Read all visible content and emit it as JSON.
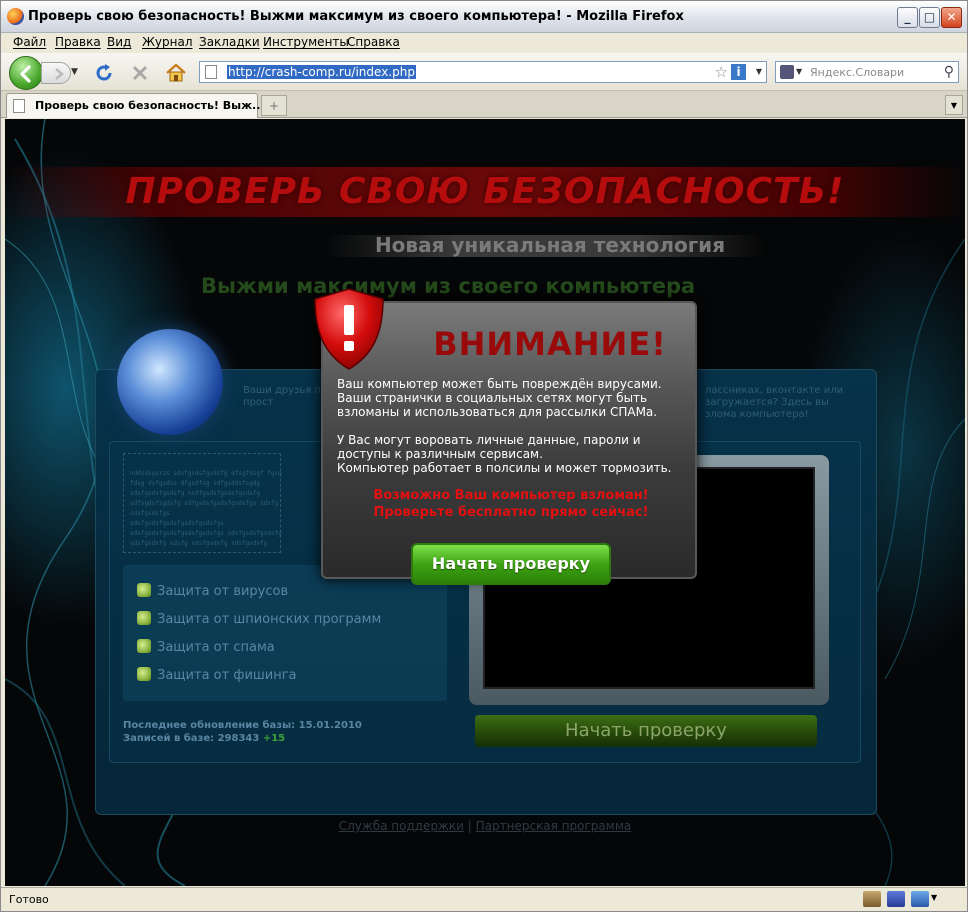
{
  "window": {
    "title": "Проверь свою безопасность! Выжми максимум из своего компьютера! - Mozilla Firefox",
    "minimize": "_",
    "maximize": "□",
    "close": "✕"
  },
  "menu": [
    "Файл",
    "Правка",
    "Вид",
    "Журнал",
    "Закладки",
    "Инструменты",
    "Справка"
  ],
  "nav": {
    "url": "http://crash-comp.ru/index.php",
    "search_placeholder": "Яндекс.Словари"
  },
  "tabs": [
    {
      "label": "Проверь свою безопасность! Выж..."
    }
  ],
  "page": {
    "headline": "ПРОВЕРЬ СВОЮ БЕЗОПАСНОСТЬ!",
    "subheadline": "Новая уникальная технология",
    "tagline": "Выжми максимум из своего компьютера",
    "description_left": "Ваши друзья п icq постоянно найдете прост",
    "description_right": "лассниках, вконтакте или загружается? Здесь вы злома компьютера!",
    "features": [
      "Защита от вирусов",
      "Защита от шпионских программ",
      "Защита от спама",
      "Защита от фишинга"
    ],
    "update_line": "Последнее обновление базы: 15.01.2010",
    "records_label": "Записей в базе: 298343",
    "records_delta": "+15",
    "start_button_bg": "Начать проверку",
    "footer_support": "Служба поддержки",
    "footer_sep": "|",
    "footer_partner": "Партнерская программа"
  },
  "modal": {
    "title": "ВНИМАНИЕ!",
    "text": [
      "Ваш компьютер может быть повреждён вирусами.",
      "Ваши странички в социальных сетях могут быть",
      "взломаны и использоваться для рассылки СПАМа.",
      "",
      "У Вас могут воровать личные данные, пароли и",
      "доступы к различным сервисам.",
      "Компьютер работает в полсилы и может тормозить."
    ],
    "warning_1": "Возможно Ваш компьютер взломан!",
    "warning_2": "Проверьте бесплатно прямо сейчас!",
    "button": "Начать проверку"
  },
  "status": {
    "text": "Готово"
  },
  "colors": {
    "headline": "#b50d0d",
    "modal_title": "#9b0a0a",
    "warning": "#e21010",
    "button_green": "#3ea314"
  }
}
